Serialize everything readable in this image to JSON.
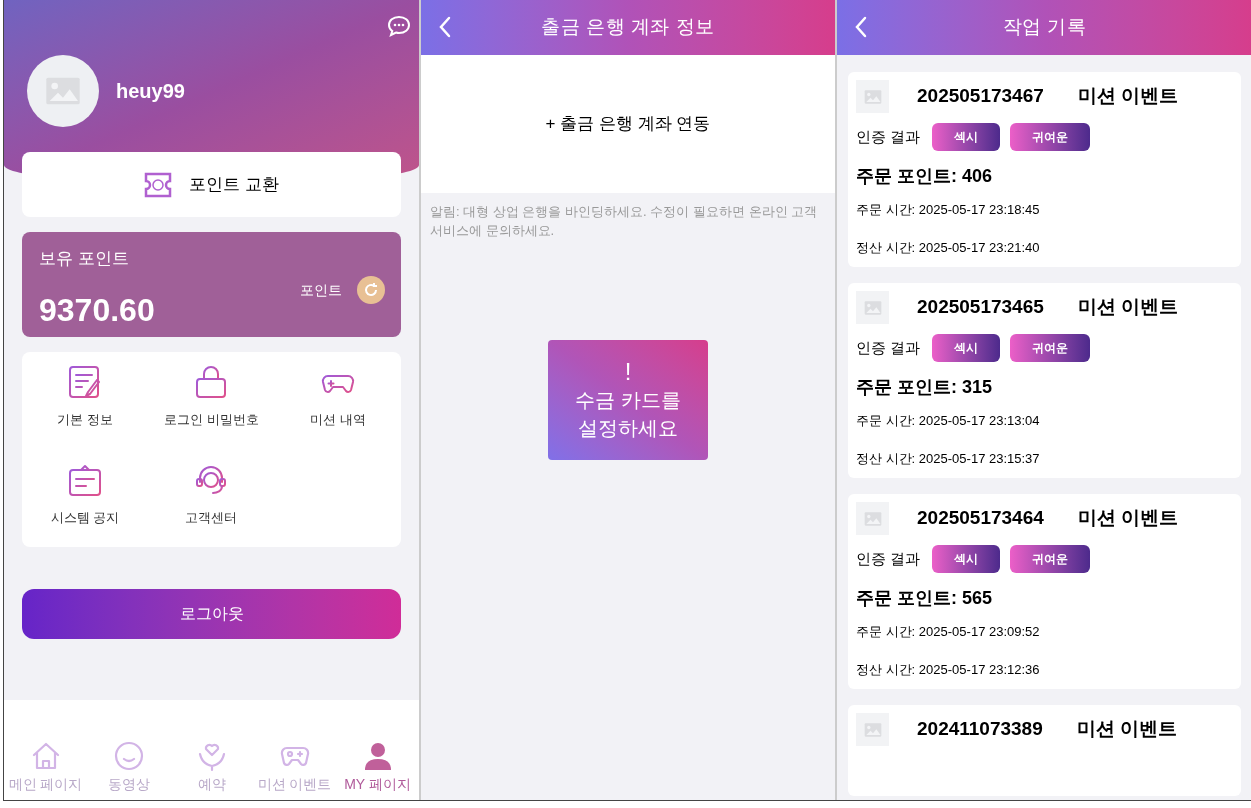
{
  "profile": {
    "username": "heuy99",
    "exchange_label": "포인트 교환",
    "balance": {
      "title": "보유 포인트",
      "unit": "포인트",
      "amount": "9370.60"
    },
    "menu": [
      {
        "kind": "info",
        "label": "기본 정보"
      },
      {
        "kind": "lock",
        "label": "로그인 비밀번호"
      },
      {
        "kind": "history",
        "label": "미션 내역"
      },
      {
        "kind": "notice",
        "label": "시스템 공지"
      },
      {
        "kind": "support",
        "label": "고객센터"
      }
    ],
    "logout": "로그아웃",
    "bottom_nav": [
      {
        "kind": "home",
        "label": "메인 페이지",
        "selected": false
      },
      {
        "kind": "video",
        "label": "동영상",
        "selected": false
      },
      {
        "kind": "heart",
        "label": "예약",
        "selected": false
      },
      {
        "kind": "game",
        "label": "미션 이벤트",
        "selected": false
      },
      {
        "kind": "user",
        "label": "MY 페이지",
        "selected": true
      }
    ]
  },
  "bank": {
    "title": "출금 은행 계좌 정보",
    "add_label": "+ 출금 은행 계좌 연동",
    "notice": "알림: 대형 상업 은행을 바인딩하세요. 수정이 필요하면 온라인 고객 서비스에 문의하세요.",
    "card": {
      "mark": "!",
      "text": "수금 카드를 설정하세요"
    }
  },
  "records": {
    "title": "작업 기록",
    "cards": [
      {
        "order_no": "202505173467",
        "type": "미션 이벤트",
        "result_label": "인증 결과",
        "tags": [
          "섹시",
          "귀여운"
        ],
        "points_label": "주문 포인트:",
        "points": "406",
        "order_time_label": "주문 시간:",
        "order_time": "2025-05-17 23:18:45",
        "settle_time_label": "정산 시간:",
        "settle_time": "2025-05-17 23:21:40"
      },
      {
        "order_no": "202505173465",
        "type": "미션 이벤트",
        "result_label": "인증 결과",
        "tags": [
          "섹시",
          "귀여운"
        ],
        "points_label": "주문 포인트:",
        "points": "315",
        "order_time_label": "주문 시간:",
        "order_time": "2025-05-17 23:13:04",
        "settle_time_label": "정산 시간:",
        "settle_time": "2025-05-17 23:15:37"
      },
      {
        "order_no": "202505173464",
        "type": "미션 이벤트",
        "result_label": "인증 결과",
        "tags": [
          "섹시",
          "귀여운"
        ],
        "points_label": "주문 포인트:",
        "points": "565",
        "order_time_label": "주문 시간:",
        "order_time": "2025-05-17 23:09:52",
        "settle_time_label": "정산 시간:",
        "settle_time": "2025-05-17 23:12:36"
      },
      {
        "order_no": "202411073389",
        "type": "미션 이벤트"
      }
    ]
  }
}
